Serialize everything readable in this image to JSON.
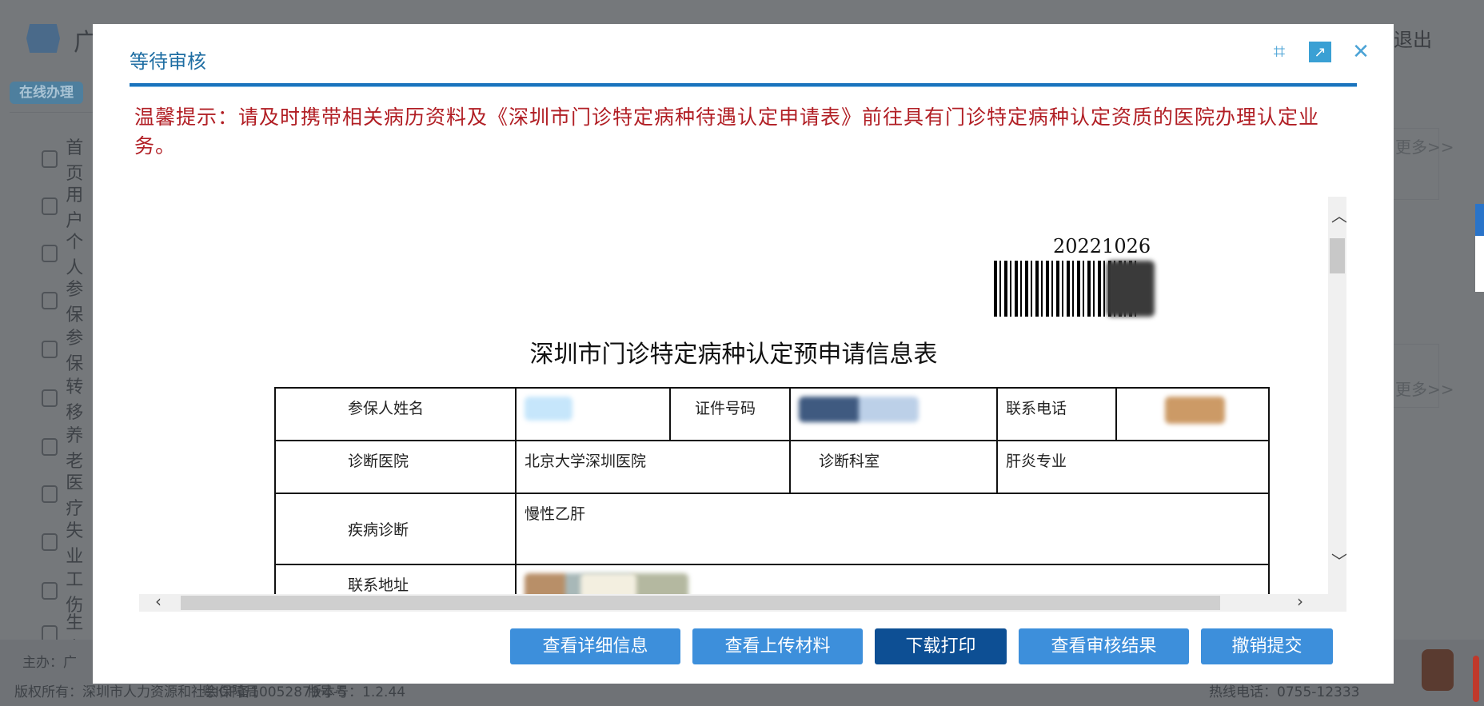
{
  "background": {
    "brand": "广",
    "exit": "退出",
    "badge": "在线办理",
    "sidebar": [
      "首页",
      "用户",
      "个人",
      "参保",
      "参保",
      "转移",
      "养老",
      "医疗",
      "失业",
      "工伤",
      "生育"
    ],
    "more": [
      "更多>>",
      "更多>>"
    ],
    "footer": {
      "host": "主办：广",
      "copyright": "版权所有：深圳市人力资源和社会保障局",
      "icp": "粤ICP备10052879号-5",
      "version": "版本号：1.2.44",
      "hotline": "热线电话：0755-12333"
    }
  },
  "dialog": {
    "title": "等待审核",
    "tip": "温馨提示：请及时携带相关病历资料及《深圳市门诊特定病种待遇认定申请表》前往具有门诊特定病种认定资质的医院办理认定业务。",
    "document": {
      "barcode_number": "20221026",
      "title": "深圳市门诊特定病种认定预申请信息表",
      "labels": {
        "name": "参保人姓名",
        "id": "证件号码",
        "phone": "联系电话",
        "hospital": "诊断医院",
        "department": "诊断科室",
        "diagnosis": "疾病诊断",
        "address": "联系地址"
      },
      "values": {
        "hospital": "北京大学深圳医院",
        "department": "肝炎专业",
        "diagnosis": "慢性乙肝"
      }
    },
    "buttons": [
      "查看详细信息",
      "查看上传材料",
      "下载打印",
      "查看审核结果",
      "撤销提交"
    ]
  }
}
